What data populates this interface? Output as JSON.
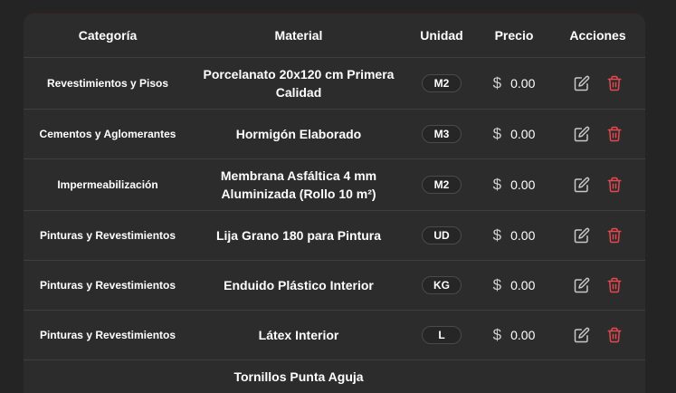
{
  "table": {
    "headers": {
      "category": "Categoría",
      "material": "Material",
      "unit": "Unidad",
      "price": "Precio",
      "actions": "Acciones"
    },
    "currency": "$",
    "rows": [
      {
        "category": "Revestimientos y Pisos",
        "material": "Porcelanato 20x120 cm Primera Calidad",
        "unit": "M2",
        "price": "0.00"
      },
      {
        "category": "Cementos y Aglomerantes",
        "material": "Hormigón Elaborado",
        "unit": "M3",
        "price": "0.00"
      },
      {
        "category": "Impermeabilización",
        "material": "Membrana Asfáltica 4 mm Aluminizada (Rollo 10 m²)",
        "unit": "M2",
        "price": "0.00"
      },
      {
        "category": "Pinturas y Revestimientos",
        "material": "Lija Grano 180 para Pintura",
        "unit": "UD",
        "price": "0.00"
      },
      {
        "category": "Pinturas y Revestimientos",
        "material": "Enduido Plástico Interior",
        "unit": "KG",
        "price": "0.00"
      },
      {
        "category": "Pinturas y Revestimientos",
        "material": "Látex Interior",
        "unit": "L",
        "price": "0.00"
      },
      {
        "category": "",
        "material": "Tornillos Punta Aguja",
        "unit": "",
        "price": ""
      }
    ]
  },
  "colors": {
    "edit_icon": "#c8c8c8",
    "delete_icon": "#e5484d"
  },
  "icons": {
    "edit": "edit-icon",
    "delete": "trash-icon"
  }
}
